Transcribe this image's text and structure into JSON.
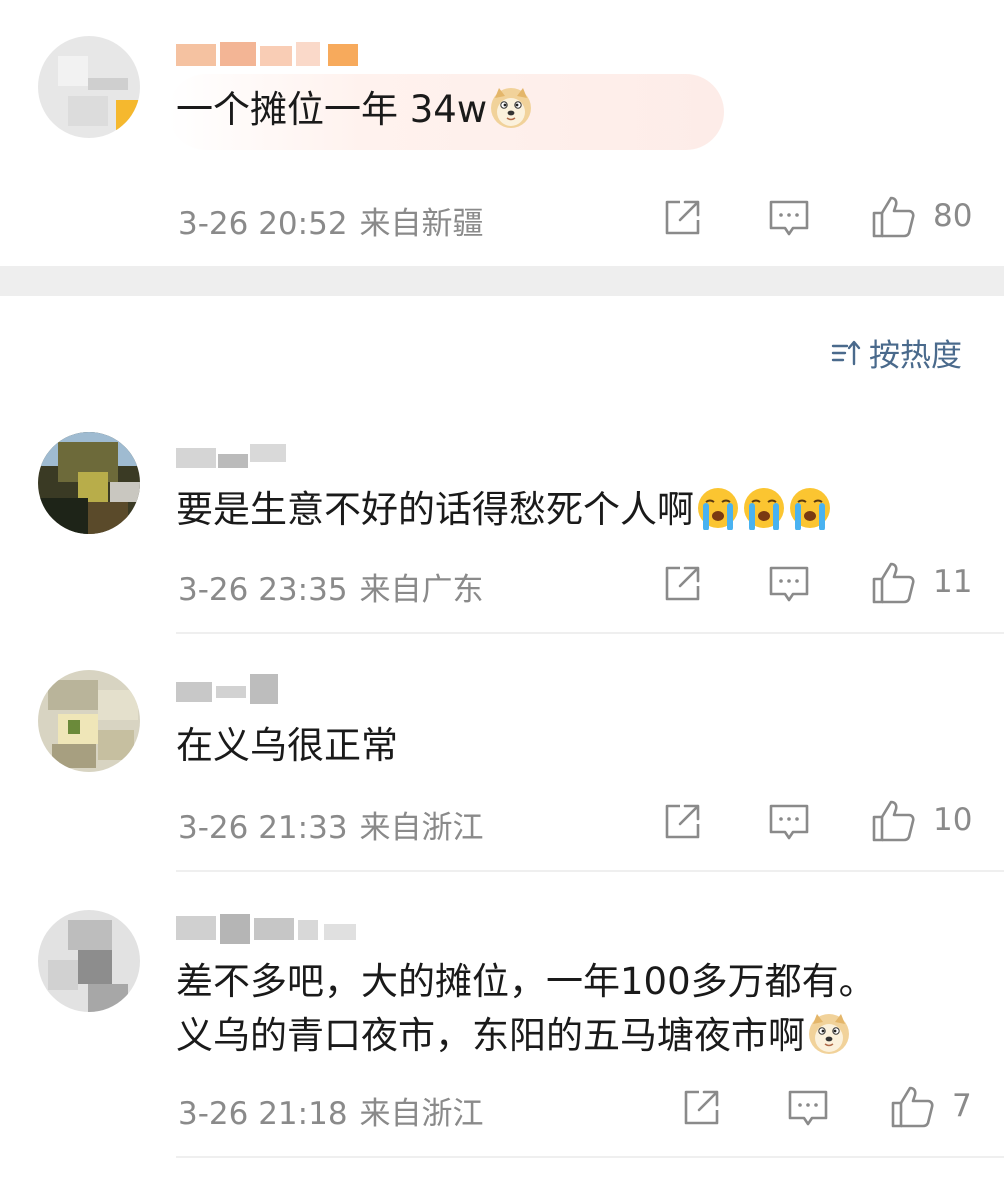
{
  "top_comment": {
    "text": "一个摊位一年 34w",
    "emoji": "doge-emoji",
    "time": "3-26 20:52",
    "region": "来自新疆",
    "likes": "80"
  },
  "sort": {
    "label": "按热度",
    "icon": "sort-icon"
  },
  "comments": [
    {
      "text": "要是生意不好的话得愁死个人啊",
      "emojis": [
        "crying-emoji",
        "crying-emoji",
        "crying-emoji"
      ],
      "time": "3-26 23:35",
      "region": "来自广东",
      "likes": "11"
    },
    {
      "text": "在义乌很正常",
      "time": "3-26 21:33",
      "region": "来自浙江",
      "likes": "10"
    },
    {
      "text_line1": "差不多吧，大的摊位，一年100多万都有。",
      "text_line2": "义乌的青口夜市，东阳的五马塘夜市啊",
      "emoji": "doge-emoji",
      "time": "3-26 21:18",
      "region": "来自浙江",
      "likes": "7"
    }
  ],
  "colors": {
    "meta_text": "#8a8a8a",
    "sort_text": "#4a6a8c",
    "gap": "#eeeeee"
  }
}
